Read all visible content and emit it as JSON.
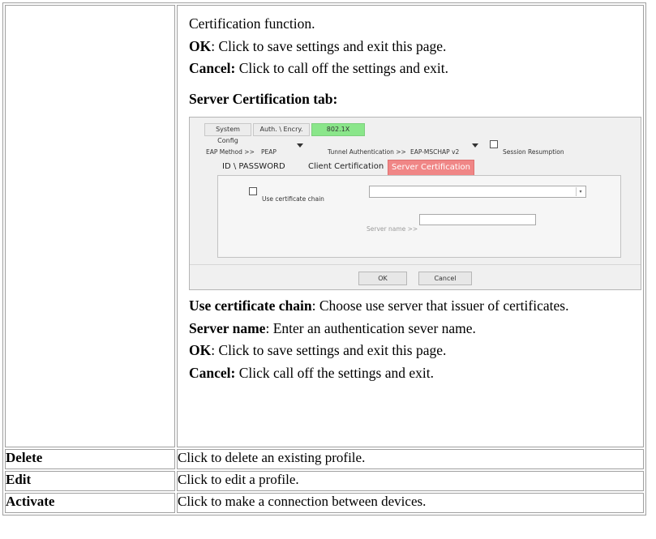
{
  "intro": {
    "line1": "Certification function.",
    "ok_term": "OK",
    "ok_text": ": Click to save settings and exit this page.",
    "cancel_term": "Cancel:",
    "cancel_text": " Click to call off the settings and exit."
  },
  "section_heading": "Server Certification tab:",
  "screenshot": {
    "tabs": [
      "System Config",
      "Auth. \\ Encry.",
      "802.1X"
    ],
    "eap_method_label": "EAP Method >>",
    "eap_method_value": "PEAP",
    "tunnel_auth_label": "Tunnel Authentication >>",
    "tunnel_auth_value": "EAP-MSCHAP v2",
    "session_resumption_label": "Session Resumption",
    "subtabs": [
      "ID \\ PASSWORD",
      "Client Certification",
      "Server Certification"
    ],
    "use_cert_chain_label": "Use certificate chain",
    "server_name_label": "Server name >>",
    "ok_button": "OK",
    "cancel_button": "Cancel"
  },
  "details": {
    "chain_term": "Use certificate chain",
    "chain_text": ": Choose use server that issuer of certificates.",
    "server_term": "Server name",
    "server_text": ": Enter an authentication sever name.",
    "ok_term": "OK",
    "ok_text": ": Click to save settings and exit this page.",
    "cancel_term": "Cancel:",
    "cancel_text": " Click call off the settings and exit."
  },
  "rows": [
    {
      "label": "Delete",
      "desc": "Click to delete an existing profile."
    },
    {
      "label": "Edit",
      "desc": "Click to edit a profile."
    },
    {
      "label": "Activate",
      "desc": "Click to make a connection between devices."
    }
  ]
}
